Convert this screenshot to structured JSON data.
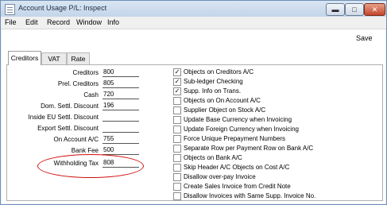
{
  "window": {
    "title": "Account Usage P/L: Inspect",
    "minimize": "▬",
    "maximize": "□",
    "close": "✕"
  },
  "menu": [
    "File",
    "Edit",
    "Record",
    "Window",
    "Info"
  ],
  "toolbar": {
    "save_label": "Save"
  },
  "tabs": [
    {
      "label": "Creditors",
      "active": true
    },
    {
      "label": "VAT",
      "active": false
    },
    {
      "label": "Rate",
      "active": false
    }
  ],
  "fields": [
    {
      "label": "Creditors",
      "value": "800"
    },
    {
      "label": "Prel. Creditors",
      "value": "805"
    },
    {
      "label": "Cash",
      "value": "720"
    },
    {
      "label": "Dom. Settl. Discount",
      "value": "196"
    },
    {
      "label": "Inside EU  Settl. Discount",
      "value": ""
    },
    {
      "label": "Export Settl. Discount",
      "value": ""
    },
    {
      "label": "On Account A/C",
      "value": "755"
    },
    {
      "label": "Bank Fee",
      "value": "500"
    },
    {
      "label": "Withholding Tax",
      "value": "808"
    }
  ],
  "checkboxes": [
    {
      "label": "Objects on Creditors A/C",
      "checked": true
    },
    {
      "label": "Sub-ledger Checking",
      "checked": true
    },
    {
      "label": "Supp. Info on Trans.",
      "checked": true
    },
    {
      "label": "Objects on On Account A/C",
      "checked": false
    },
    {
      "label": "Supplier Object on Stock A/C",
      "checked": false
    },
    {
      "label": "Update Base Currency when Invoicing",
      "checked": false
    },
    {
      "label": "Update Foreign Currency when Invoicing",
      "checked": false
    },
    {
      "label": "Force Unique Prepayment Numbers",
      "checked": false
    },
    {
      "label": "Separate Row per Payment Row on Bank A/C",
      "checked": false
    },
    {
      "label": "Objects on Bank A/C",
      "checked": false
    },
    {
      "label": "Skip Header A/C Objects on Cost A/C",
      "checked": false
    },
    {
      "label": "Disallow over-pay Invoice",
      "checked": false
    },
    {
      "label": "Create Sales Invoice from Credit Note",
      "checked": false
    },
    {
      "label": "Disallow Invoices with Same Supp. Invoice No.",
      "checked": false
    }
  ],
  "colors": {
    "highlight": "#d10f0f"
  },
  "check_mark": "✓"
}
